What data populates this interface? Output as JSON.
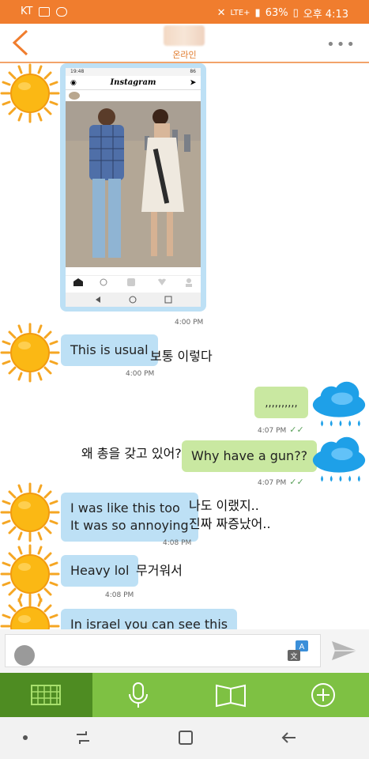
{
  "status_bar": {
    "carrier": "KT",
    "network": "LTE+",
    "battery": "63%",
    "time": "오후 4:13"
  },
  "header": {
    "status": "온라인"
  },
  "shared_image": {
    "status_time": "19:48",
    "status_battery": "86",
    "app_title": "Instagram"
  },
  "messages": [
    {
      "id": "m1",
      "side": "in",
      "type": "image",
      "time": "4:00 PM"
    },
    {
      "id": "m2",
      "side": "in",
      "text": "This is usual",
      "note": "보통 이렇다",
      "time": "4:00 PM"
    },
    {
      "id": "m3",
      "side": "out",
      "text": ",,,,,,,,,,",
      "time": "4:07 PM"
    },
    {
      "id": "m4",
      "side": "out",
      "text": "Why have a gun??",
      "note": "왜 총을 갖고 있어?",
      "time": "4:07 PM"
    },
    {
      "id": "m5",
      "side": "in",
      "line1": "I was like this too",
      "line2": "It was so annoying",
      "note1": "나도 이랬지..",
      "note2": "진짜 짜증났어..",
      "time": "4:08 PM"
    },
    {
      "id": "m6",
      "side": "in",
      "text": "Heavy lol",
      "note": "무거워서",
      "time": "4:08 PM"
    },
    {
      "id": "m7",
      "side": "in",
      "text": "In israel you can see this"
    }
  ],
  "icons": {
    "back": "chevron-left-icon",
    "more": "more-dots-icon",
    "read": "double-check-icon",
    "translate": "translate-icon",
    "send": "send-icon",
    "keyboard": "keyboard-icon",
    "mic": "microphone-icon",
    "book": "book-icon",
    "add": "plus-circle-icon"
  },
  "colors": {
    "status_bar": "#f07d2e",
    "incoming_bubble": "#bde0f5",
    "outgoing_bubble": "#c9e8a1",
    "toolbar": "#7ec143",
    "toolbar_active": "#4e8c22"
  }
}
